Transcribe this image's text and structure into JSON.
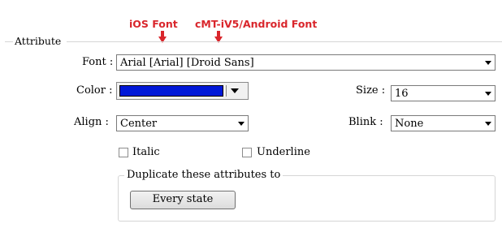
{
  "annotations": {
    "ios_font": "iOS Font",
    "android_font": "cMT-iV5/Android Font",
    "arrow_color": "#d9262c"
  },
  "group": {
    "title": "Attribute"
  },
  "font": {
    "label": "Font :",
    "value": "Arial [Arial] [Droid Sans]"
  },
  "color": {
    "label": "Color :",
    "swatch": "#0018d8"
  },
  "size": {
    "label": "Size :",
    "value": "16"
  },
  "align": {
    "label": "Align :",
    "value": "Center"
  },
  "blink": {
    "label": "Blink :",
    "value": "None"
  },
  "italic": {
    "label": "Italic",
    "checked": false
  },
  "underline": {
    "label": "Underline",
    "checked": false
  },
  "duplicate": {
    "title": "Duplicate these attributes to",
    "button": "Every state"
  }
}
